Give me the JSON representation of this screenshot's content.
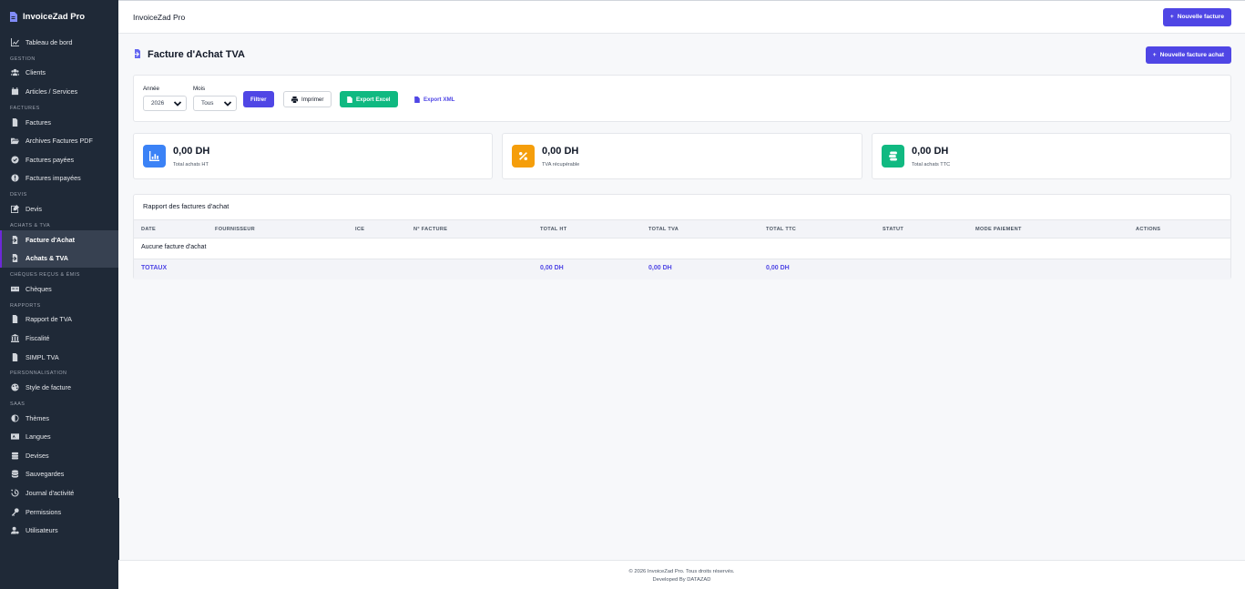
{
  "brand": {
    "name": "InvoiceZad Pro"
  },
  "sidebar": {
    "dashboard": "Tableau de bord",
    "sections": {
      "gestion": "GESTION",
      "factures": "FACTURES",
      "devis": "DEVIS",
      "achats": "ACHATS & TVA",
      "cheques": "CHÈQUES REÇUS & ÉMIS",
      "rapports": "RAPPORTS",
      "perso": "PERSONNALISATION",
      "saas": "SAAS"
    },
    "items": {
      "clients": "Clients",
      "articles": "Articles / Services",
      "factures": "Factures",
      "archives": "Archives Factures PDF",
      "payees": "Factures payées",
      "impayees": "Factures impayées",
      "devis": "Devis",
      "facture_achat": "Facture d'Achat",
      "achats_tva": "Achats & TVA",
      "cheques": "Chèques",
      "rapport_tva": "Rapport de TVA",
      "fiscalite": "Fiscalité",
      "simpl_tva": "SIMPL TVA",
      "style": "Style de facture",
      "themes": "Thèmes",
      "langues": "Langues",
      "devises": "Devises",
      "sauvegardes": "Sauvegardes",
      "journal": "Journal d'activité",
      "permissions": "Permissions",
      "utilisateurs": "Utilisateurs"
    }
  },
  "topbar": {
    "title": "InvoiceZad Pro",
    "new_invoice": "Nouvelle facture"
  },
  "page": {
    "title": "Facture d'Achat TVA",
    "new_purchase": "Nouvelle facture achat"
  },
  "filters": {
    "year_label": "Année",
    "year_value": "2026",
    "month_label": "Mois",
    "month_value": "Tous",
    "filter_btn": "Filtrer",
    "print_btn": "Imprimer",
    "excel_btn": "Export Excel",
    "xml_btn": "Export XML"
  },
  "stats": {
    "ht": {
      "amount": "0,00 DH",
      "caption": "Total achats HT",
      "color": "#3b82f6"
    },
    "tva": {
      "amount": "0,00 DH",
      "caption": "TVA récupérable",
      "color": "#f59e0b"
    },
    "ttc": {
      "amount": "0,00 DH",
      "caption": "Total achats TTC",
      "color": "#10b981"
    }
  },
  "report": {
    "title": "Rapport des factures d'achat",
    "columns": {
      "date": "DATE",
      "fournisseur": "FOURNISSEUR",
      "ice": "ICE",
      "num": "N° FACTURE",
      "ht": "TOTAL HT",
      "tva": "TOTAL TVA",
      "ttc": "TOTAL TTC",
      "statut": "STATUT",
      "mode": "MODE PAIEMENT",
      "actions": "ACTIONS"
    },
    "empty": "Aucune facture d'achat",
    "totals": {
      "label": "TOTAUX",
      "ht": "0,00 DH",
      "tva": "0,00 DH",
      "ttc": "0,00 DH"
    }
  },
  "footer": {
    "line1": "© 2026 InvoiceZad Pro. Tous droits réservés.",
    "line2": "Developed By DATAZAD"
  }
}
